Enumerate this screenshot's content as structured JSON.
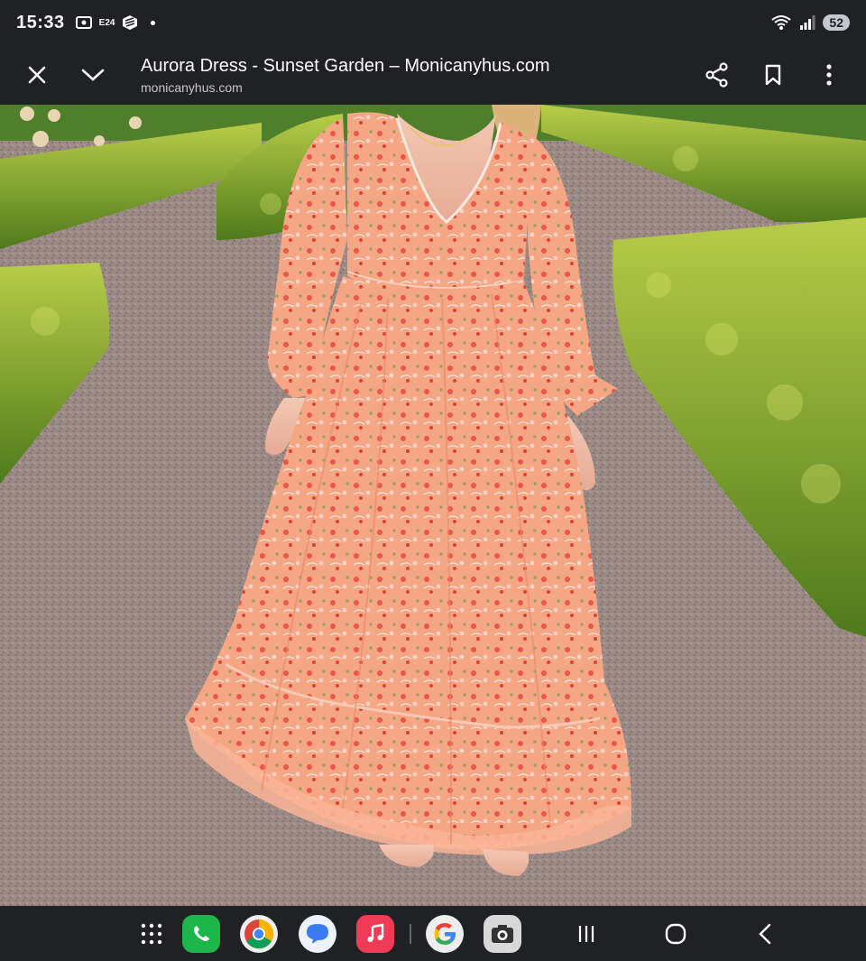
{
  "status_bar": {
    "time": "15:33",
    "network_badge": "E24",
    "battery": "52"
  },
  "toolbar": {
    "title": "Aurora Dress - Sunset Garden – Monicanyhus.com",
    "url": "monicanyhus.com"
  },
  "icons": {
    "close": "close-icon",
    "minimize": "chevron-down-icon",
    "share": "share-icon",
    "bookmark": "bookmark-icon",
    "menu": "more-vert-icon"
  },
  "dock": {
    "apps": [
      "phone",
      "chrome",
      "messages",
      "music",
      "google",
      "camera"
    ]
  },
  "colors": {
    "system_bar": "#202124",
    "dress": "#f4a07e",
    "hedge": "#7fa630",
    "gravel": "#9c8c86"
  }
}
